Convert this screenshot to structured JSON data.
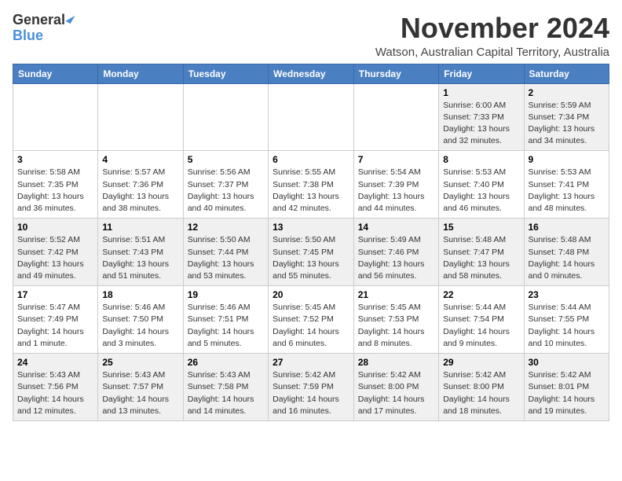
{
  "header": {
    "logo_line1": "General",
    "logo_line2": "Blue",
    "month": "November 2024",
    "location": "Watson, Australian Capital Territory, Australia"
  },
  "weekdays": [
    "Sunday",
    "Monday",
    "Tuesday",
    "Wednesday",
    "Thursday",
    "Friday",
    "Saturday"
  ],
  "weeks": [
    [
      {
        "day": "",
        "info": ""
      },
      {
        "day": "",
        "info": ""
      },
      {
        "day": "",
        "info": ""
      },
      {
        "day": "",
        "info": ""
      },
      {
        "day": "",
        "info": ""
      },
      {
        "day": "1",
        "info": "Sunrise: 6:00 AM\nSunset: 7:33 PM\nDaylight: 13 hours\nand 32 minutes."
      },
      {
        "day": "2",
        "info": "Sunrise: 5:59 AM\nSunset: 7:34 PM\nDaylight: 13 hours\nand 34 minutes."
      }
    ],
    [
      {
        "day": "3",
        "info": "Sunrise: 5:58 AM\nSunset: 7:35 PM\nDaylight: 13 hours\nand 36 minutes."
      },
      {
        "day": "4",
        "info": "Sunrise: 5:57 AM\nSunset: 7:36 PM\nDaylight: 13 hours\nand 38 minutes."
      },
      {
        "day": "5",
        "info": "Sunrise: 5:56 AM\nSunset: 7:37 PM\nDaylight: 13 hours\nand 40 minutes."
      },
      {
        "day": "6",
        "info": "Sunrise: 5:55 AM\nSunset: 7:38 PM\nDaylight: 13 hours\nand 42 minutes."
      },
      {
        "day": "7",
        "info": "Sunrise: 5:54 AM\nSunset: 7:39 PM\nDaylight: 13 hours\nand 44 minutes."
      },
      {
        "day": "8",
        "info": "Sunrise: 5:53 AM\nSunset: 7:40 PM\nDaylight: 13 hours\nand 46 minutes."
      },
      {
        "day": "9",
        "info": "Sunrise: 5:53 AM\nSunset: 7:41 PM\nDaylight: 13 hours\nand 48 minutes."
      }
    ],
    [
      {
        "day": "10",
        "info": "Sunrise: 5:52 AM\nSunset: 7:42 PM\nDaylight: 13 hours\nand 49 minutes."
      },
      {
        "day": "11",
        "info": "Sunrise: 5:51 AM\nSunset: 7:43 PM\nDaylight: 13 hours\nand 51 minutes."
      },
      {
        "day": "12",
        "info": "Sunrise: 5:50 AM\nSunset: 7:44 PM\nDaylight: 13 hours\nand 53 minutes."
      },
      {
        "day": "13",
        "info": "Sunrise: 5:50 AM\nSunset: 7:45 PM\nDaylight: 13 hours\nand 55 minutes."
      },
      {
        "day": "14",
        "info": "Sunrise: 5:49 AM\nSunset: 7:46 PM\nDaylight: 13 hours\nand 56 minutes."
      },
      {
        "day": "15",
        "info": "Sunrise: 5:48 AM\nSunset: 7:47 PM\nDaylight: 13 hours\nand 58 minutes."
      },
      {
        "day": "16",
        "info": "Sunrise: 5:48 AM\nSunset: 7:48 PM\nDaylight: 14 hours\nand 0 minutes."
      }
    ],
    [
      {
        "day": "17",
        "info": "Sunrise: 5:47 AM\nSunset: 7:49 PM\nDaylight: 14 hours\nand 1 minute."
      },
      {
        "day": "18",
        "info": "Sunrise: 5:46 AM\nSunset: 7:50 PM\nDaylight: 14 hours\nand 3 minutes."
      },
      {
        "day": "19",
        "info": "Sunrise: 5:46 AM\nSunset: 7:51 PM\nDaylight: 14 hours\nand 5 minutes."
      },
      {
        "day": "20",
        "info": "Sunrise: 5:45 AM\nSunset: 7:52 PM\nDaylight: 14 hours\nand 6 minutes."
      },
      {
        "day": "21",
        "info": "Sunrise: 5:45 AM\nSunset: 7:53 PM\nDaylight: 14 hours\nand 8 minutes."
      },
      {
        "day": "22",
        "info": "Sunrise: 5:44 AM\nSunset: 7:54 PM\nDaylight: 14 hours\nand 9 minutes."
      },
      {
        "day": "23",
        "info": "Sunrise: 5:44 AM\nSunset: 7:55 PM\nDaylight: 14 hours\nand 10 minutes."
      }
    ],
    [
      {
        "day": "24",
        "info": "Sunrise: 5:43 AM\nSunset: 7:56 PM\nDaylight: 14 hours\nand 12 minutes."
      },
      {
        "day": "25",
        "info": "Sunrise: 5:43 AM\nSunset: 7:57 PM\nDaylight: 14 hours\nand 13 minutes."
      },
      {
        "day": "26",
        "info": "Sunrise: 5:43 AM\nSunset: 7:58 PM\nDaylight: 14 hours\nand 14 minutes."
      },
      {
        "day": "27",
        "info": "Sunrise: 5:42 AM\nSunset: 7:59 PM\nDaylight: 14 hours\nand 16 minutes."
      },
      {
        "day": "28",
        "info": "Sunrise: 5:42 AM\nSunset: 8:00 PM\nDaylight: 14 hours\nand 17 minutes."
      },
      {
        "day": "29",
        "info": "Sunrise: 5:42 AM\nSunset: 8:00 PM\nDaylight: 14 hours\nand 18 minutes."
      },
      {
        "day": "30",
        "info": "Sunrise: 5:42 AM\nSunset: 8:01 PM\nDaylight: 14 hours\nand 19 minutes."
      }
    ]
  ]
}
